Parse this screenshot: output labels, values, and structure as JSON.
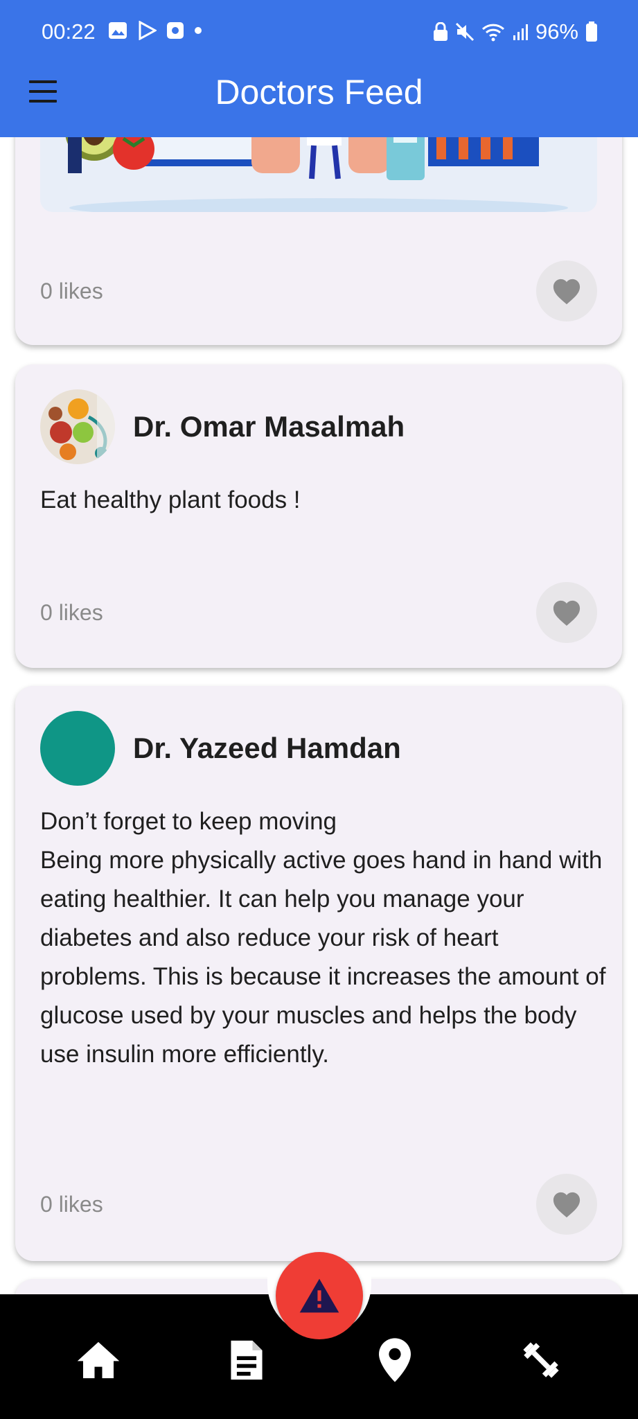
{
  "status_bar": {
    "time": "00:22",
    "battery": "96%"
  },
  "app_bar": {
    "title": "Doctors Feed"
  },
  "posts": [
    {
      "likes": "0 likes"
    },
    {
      "author": "Dr. Omar Masalmah",
      "text": "Eat healthy plant foods !",
      "likes": "0 likes"
    },
    {
      "author": "Dr. Yazeed Hamdan",
      "text": "Don’t forget to keep moving\nBeing more physically active goes hand in hand with eating healthier. It can help you manage your diabetes and also reduce your risk of heart problems. This is because it increases the amount of glucose used by your muscles and helps the body use insulin more efficiently.",
      "likes": "0 likes",
      "avatar_color": "#0f9686"
    }
  ],
  "bottom_nav": {
    "items": [
      "home-icon",
      "article-icon",
      "location-icon",
      "fitness-icon"
    ],
    "fab_icon": "warning-icon"
  },
  "colors": {
    "app_bar": "#3a74e8",
    "card": "#f4f0f7",
    "fab": "#ef3d35"
  }
}
